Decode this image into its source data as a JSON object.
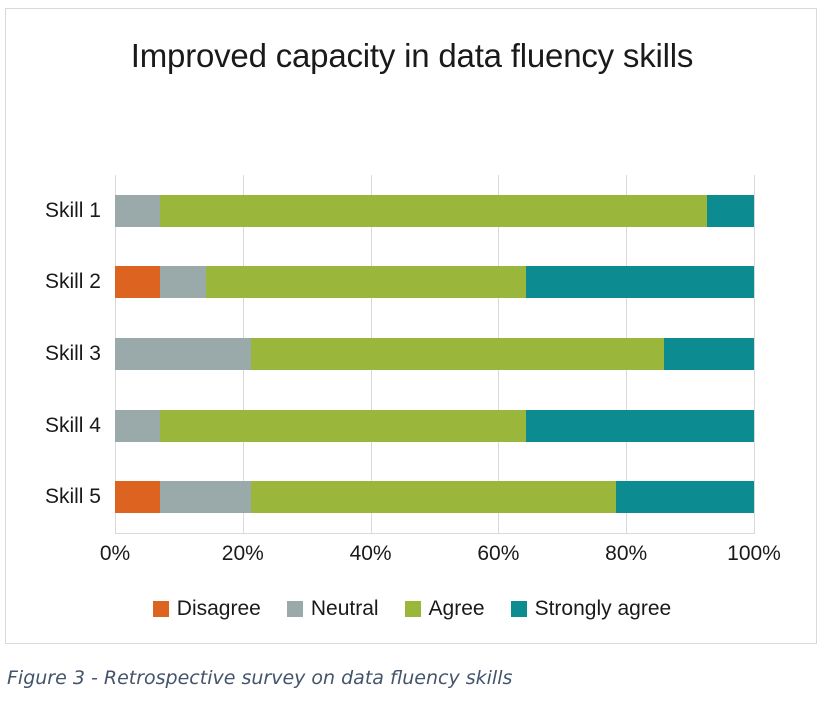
{
  "figure": {
    "caption": "Figure 3 - Retrospective survey on data fluency skills",
    "caption_color": "#44546a",
    "border_color": "#d9d9d9"
  },
  "chart_data": {
    "type": "bar",
    "orientation": "horizontal",
    "stacked": true,
    "stack_mode": "percent",
    "title": "Improved capacity in data fluency skills",
    "xlabel": "",
    "ylabel": "",
    "xlim": [
      0,
      100
    ],
    "xticks": [
      0,
      20,
      40,
      60,
      80,
      100
    ],
    "xtick_labels": [
      "0%",
      "20%",
      "40%",
      "60%",
      "80%",
      "100%"
    ],
    "grid": "vertical",
    "legend_position": "bottom",
    "categories": [
      "Skill 1",
      "Skill 2",
      "Skill 3",
      "Skill 4",
      "Skill 5"
    ],
    "series": [
      {
        "name": "Disagree",
        "color": "#dd6420",
        "values": [
          0,
          7.0,
          0,
          0,
          7.0
        ]
      },
      {
        "name": "Neutral",
        "color": "#9aa9aa",
        "values": [
          7.0,
          7.2,
          21.3,
          7.0,
          14.3
        ]
      },
      {
        "name": "Agree",
        "color": "#9ab73b",
        "values": [
          85.6,
          50.1,
          64.6,
          57.3,
          57.1
        ]
      },
      {
        "name": "Strongly agree",
        "color": "#0c8b90",
        "values": [
          7.4,
          35.7,
          14.1,
          35.7,
          21.6
        ]
      }
    ]
  }
}
